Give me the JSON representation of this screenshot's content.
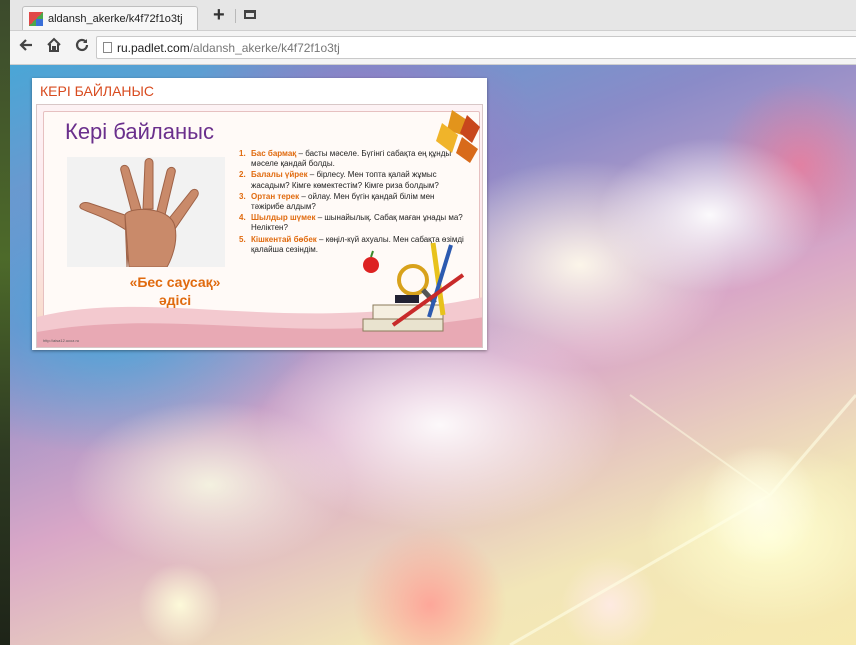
{
  "browser": {
    "tab_title": "aldansh_akerke/k4f72f1o3tj",
    "new_tab_label": "+",
    "url_domain": "ru.padlet.com",
    "url_path": "/aldansh_akerke/k4f72f1o3tj"
  },
  "post": {
    "title": "КЕРІ БАЙЛАНЫС",
    "slide": {
      "heading": "Кері байланыс",
      "method_line1": "«Бес саусақ»",
      "method_line2": "әдісі",
      "footer_url": "http://aisa12.ucoz.ru",
      "items": [
        {
          "num": "1.",
          "keyword": "Бас бармақ",
          "text": " – басты мәселе. Бүгінгі сабақта ең құнды мәселе қандай болды."
        },
        {
          "num": "2.",
          "keyword": "Балалы үйрек",
          "text": " – бірлесу. Мен топта қалай жұмыс жасадым? Кімге көмектестім? Кімге риза болдым?"
        },
        {
          "num": "3.",
          "keyword": "Ортан терек",
          "text": " – ойлау. Мен бүгін қандай білім мен тәжірибе алдым?"
        },
        {
          "num": "4.",
          "keyword": "Шылдыр шүмек",
          "text": " – шынайылық. Сабақ маған ұнады ма? Неліктен?"
        },
        {
          "num": "5.",
          "keyword": "Кішкентай бөбек",
          "text": " – көңіл-күй ахуалы. Мен сабақта өзімді қалайша сезіндім."
        }
      ]
    }
  }
}
